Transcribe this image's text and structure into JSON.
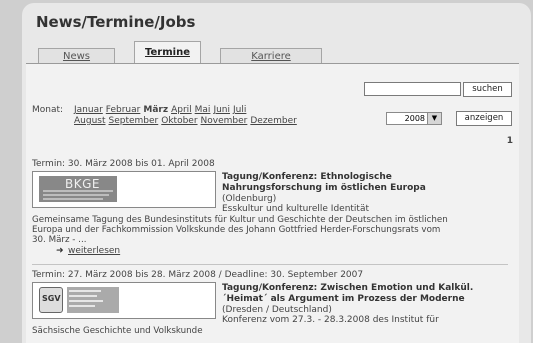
{
  "page": {
    "title": "News/Termine/Jobs"
  },
  "tabs": [
    {
      "label": "News",
      "active": false
    },
    {
      "label": "Termine",
      "active": true
    },
    {
      "label": "Karriere",
      "active": false
    }
  ],
  "search": {
    "value": "",
    "button_label": "suchen"
  },
  "month_filter": {
    "label": "Monat:",
    "row1": [
      "Januar",
      "Februar",
      "März",
      "April",
      "Mai",
      "Juni",
      "Juli"
    ],
    "row2": [
      "August",
      "September",
      "Oktober",
      "November",
      "Dezember"
    ],
    "current": "März"
  },
  "year_filter": {
    "selected": "2008",
    "button_label": "anzeigen"
  },
  "pagination": {
    "page": "1"
  },
  "events": [
    {
      "date_line": "Termin: 30. März 2008 bis 01. April 2008",
      "logo_text": "BKGE",
      "title_line1": "Tagung/Konferenz: Ethnologische",
      "title_line2": "Nahrungsforschung im östlichen Europa",
      "location": "(Oldenburg)",
      "subtitle": "Esskultur und kulturelle Identität",
      "desc1": "Gemeinsame Tagung des Bundesinstituts für Kultur und Geschichte der Deutschen im östlichen",
      "desc2": "Europa und der Fachkommission Volkskunde des Johann Gottfried Herder-Forschungsrats vom",
      "desc3": "30. März - ...",
      "more_label": "weiterlesen"
    },
    {
      "date_line": "Termin: 27. März 2008 bis 28. März 2008 / Deadline: 30. September 2007",
      "logo_text": "SGV",
      "title_line1": "Tagung/Konferenz: Zwischen Emotion und Kalkül.",
      "title_line2": "´Heimat´ als Argument im Prozess der Moderne",
      "location": "(Dresden / Deutschland)",
      "subtitle": "Konferenz vom 27.3. - 28.3.2008 des Institut für",
      "desc1": "Sächsische Geschichte und Volkskunde"
    }
  ]
}
